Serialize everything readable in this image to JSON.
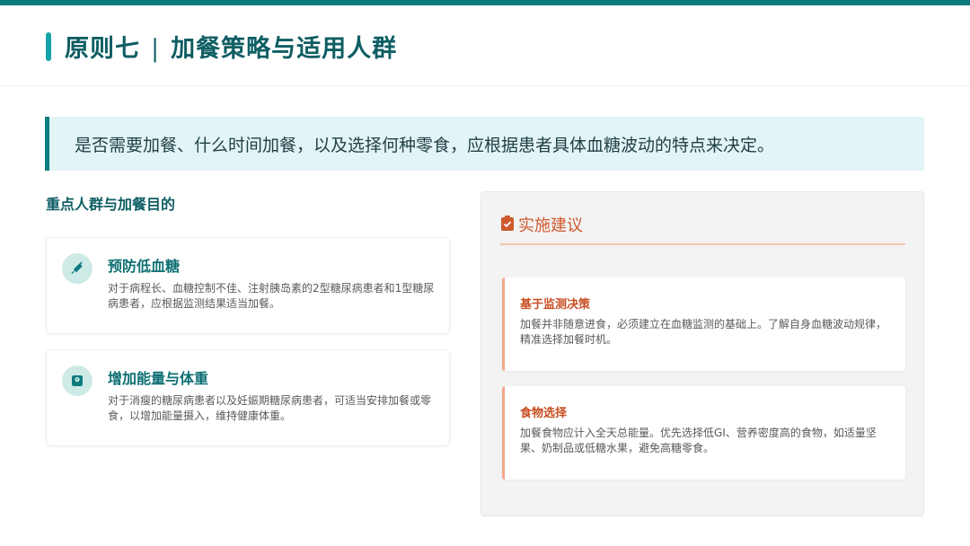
{
  "header": {
    "title_main": "原则七",
    "title_sep": "|",
    "title_sub": "加餐策略与适用人群"
  },
  "banner": {
    "text": "是否需要加餐、什么时间加餐，以及选择何种零食，应根据患者具体血糖波动的特点来决定。"
  },
  "left": {
    "section_title": "重点人群与加餐目的",
    "cards": [
      {
        "icon": "syringe-icon",
        "title": "预防低血糖",
        "text": "对于病程长、血糖控制不佳、注射胰岛素的2型糖尿病患者和1型糖尿病患者，应根据监测结果适当加餐。"
      },
      {
        "icon": "weight-scale-icon",
        "title": "增加能量与体重",
        "text": "对于消瘦的糖尿病患者以及妊娠期糖尿病患者，可适当安排加餐或零食，以增加能量摄入，维持健康体重。"
      }
    ]
  },
  "right": {
    "panel_icon": "clipboard-check-icon",
    "panel_title": "实施建议",
    "items": [
      {
        "title": "基于监测决策",
        "text": "加餐并非随意进食，必须建立在血糖监测的基础上。了解自身血糖波动规律，精准选择加餐时机。"
      },
      {
        "title": "食物选择",
        "text": "加餐食物应计入全天总能量。优先选择低GI、营养密度高的食物，如适量坚果、奶制品或低糖水果，避免高糖零食。"
      }
    ]
  },
  "colors": {
    "primary": "#0e7b80",
    "accent": "#cf5a2e",
    "banner_bg": "#e2f4f6"
  }
}
